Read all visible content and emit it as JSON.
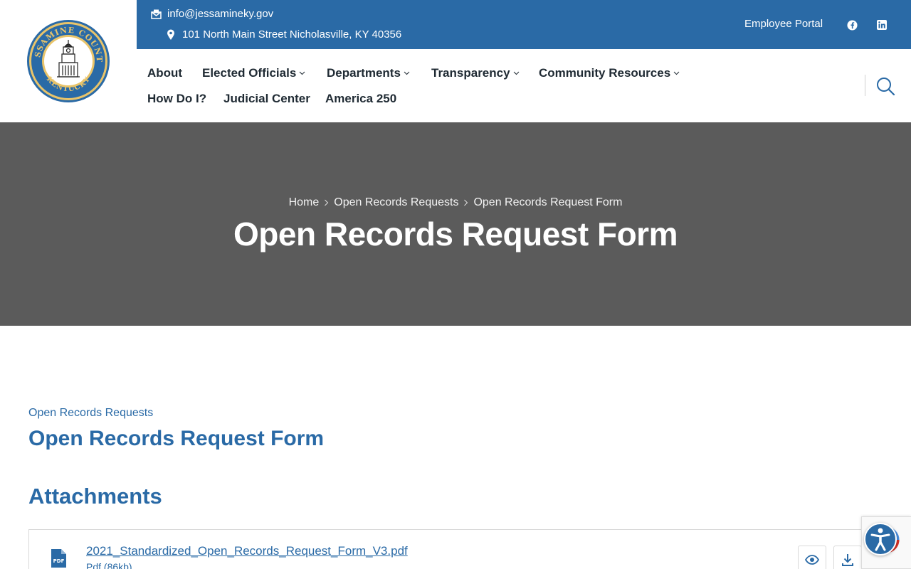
{
  "header": {
    "logo": {
      "top_text": "JESSAMINE COUNTY",
      "bottom_text": "KENTUCKY"
    },
    "contact": {
      "email": "info@jessamineky.gov",
      "address": "101 North Main Street Nicholasville, KY 40356"
    },
    "portal_label": "Employee Portal",
    "social": [
      "facebook-icon",
      "linkedin-icon"
    ],
    "brand_color": "#2a6aa6"
  },
  "nav": {
    "items": [
      {
        "label": "About",
        "has_dropdown": false
      },
      {
        "label": "Elected Officials",
        "has_dropdown": true
      },
      {
        "label": "Departments",
        "has_dropdown": true
      },
      {
        "label": "Transparency",
        "has_dropdown": true
      },
      {
        "label": "Community Resources",
        "has_dropdown": true
      },
      {
        "label": "How Do I?",
        "has_dropdown": false
      },
      {
        "label": "Judicial Center",
        "has_dropdown": false
      },
      {
        "label": "America 250",
        "has_dropdown": false
      }
    ]
  },
  "hero": {
    "breadcrumb": [
      "Home",
      "Open Records Requests",
      "Open Records Request Form"
    ],
    "title": "Open Records Request Form",
    "background": "#5b5b5b"
  },
  "main": {
    "category": "Open Records Requests",
    "title": "Open Records Request Form",
    "attachments_heading": "Attachments",
    "attachments": [
      {
        "icon": "pdf-icon",
        "filename": "2021_Standardized_Open_Records_Request_Form_V3.pdf",
        "meta": "Pdf (86kb)"
      }
    ]
  }
}
